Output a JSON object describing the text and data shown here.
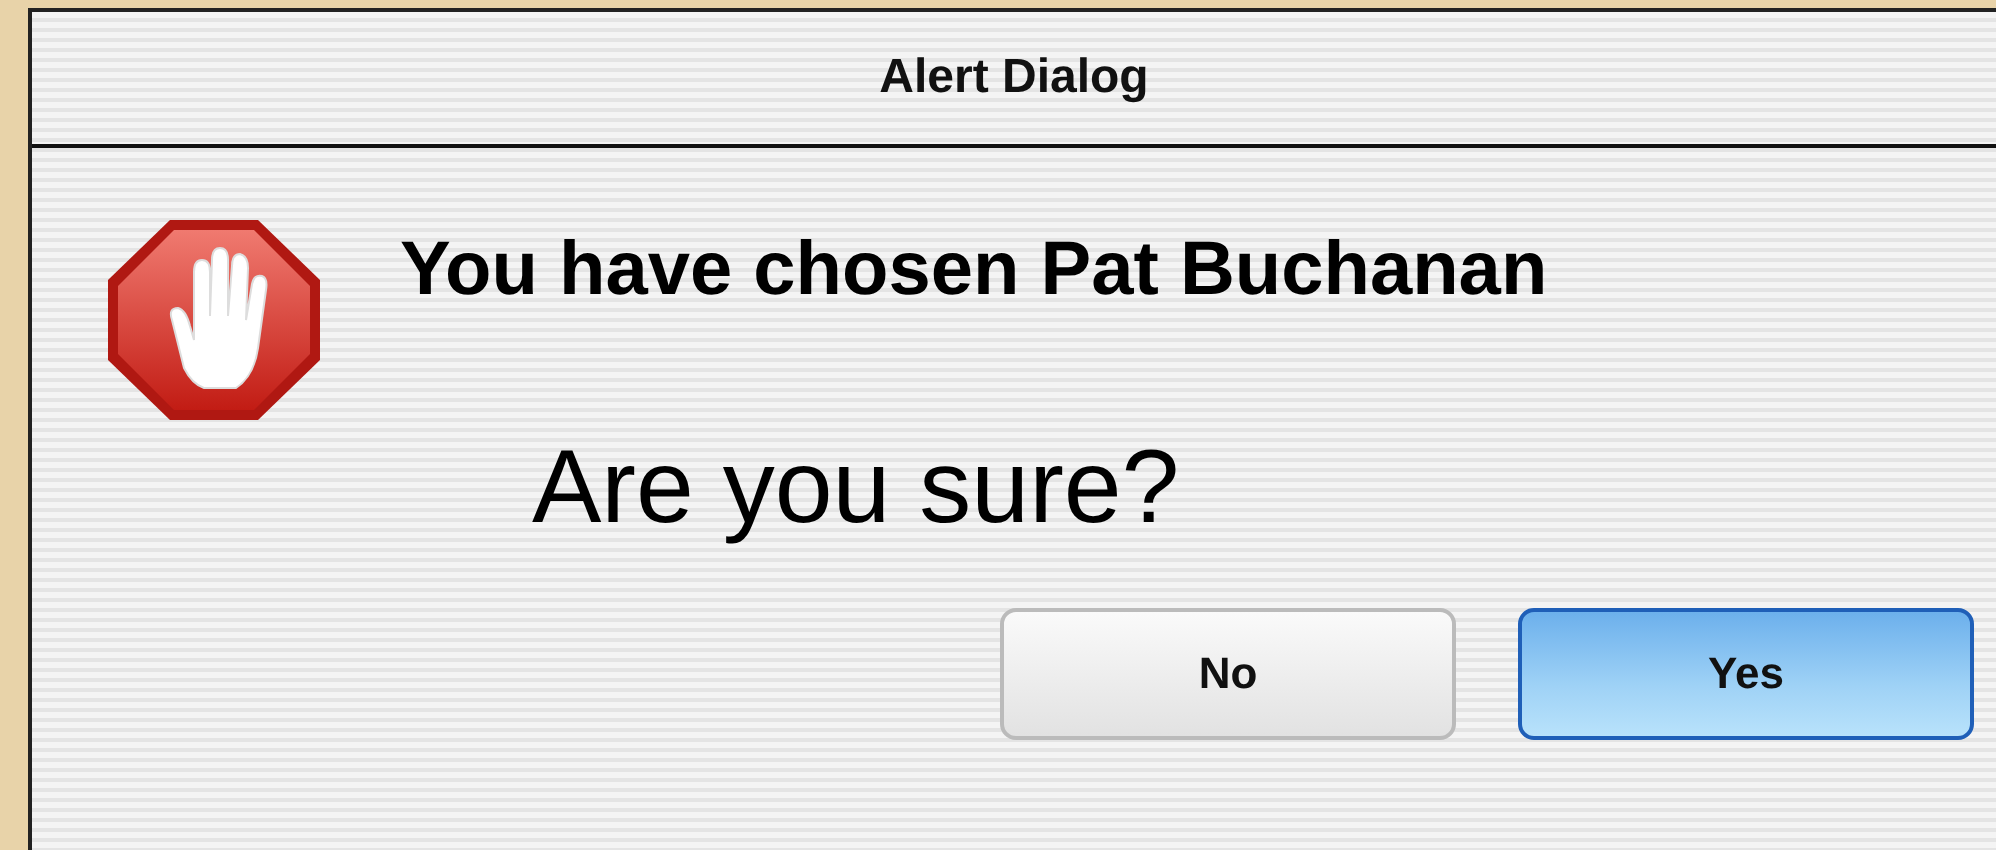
{
  "window": {
    "title": "Alert Dialog"
  },
  "heading": "You have chosen Pat Buchanan",
  "message": "Are you sure?",
  "buttons": [
    {
      "label": "No",
      "default": false
    },
    {
      "label": "Yes",
      "default": true
    }
  ]
}
